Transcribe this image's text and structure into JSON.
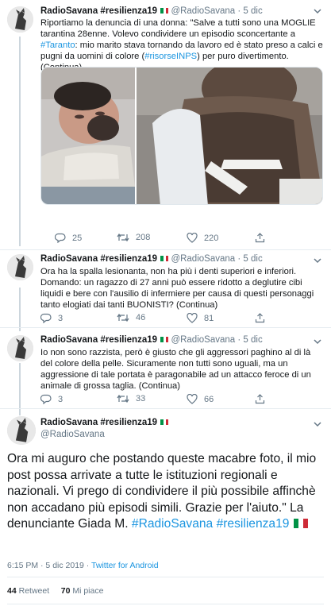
{
  "colors": {
    "link": "#1b95e0",
    "muted": "#657786",
    "text": "#14171a",
    "divider": "#e6ecf0",
    "like_red": "#e0245e"
  },
  "tweets": [
    {
      "name": "RadioSavana #resilienza19",
      "handle": "@RadioSavana",
      "date": "· 5 dic",
      "text_a": "Riportiamo la denuncia di una donna: \"Salve a tutti sono una MOGLIE tarantina 28enne. Volevo condividere un episodio sconcertante a ",
      "link_a": "#Taranto",
      "text_b": ": mio marito stava tornando da lavoro ed è stato preso a calci e pugni da uomini di colore (",
      "link_b": "#risorseINPS",
      "text_c": ") per puro divertimento. (Continua)",
      "replies": "25",
      "retweets": "208",
      "likes": "220"
    },
    {
      "name": "RadioSavana #resilienza19",
      "handle": "@RadioSavana",
      "date": "· 5 dic",
      "text": "Ora ha la spalla lesionanta, non ha più i denti superiori e inferiori. Domando: un ragazzo di 27 anni può essere ridotto a deglutire cibi liquidi e bere con l'ausilio di infermiere per causa di questi personaggi tanto elogiati dai tanti BUONISTI? (Continua)",
      "replies": "3",
      "retweets": "46",
      "likes": "81"
    },
    {
      "name": "RadioSavana #resilienza19",
      "handle": "@RadioSavana",
      "date": "· 5 dic",
      "text": "Io non sono razzista, però è giusto che gli aggressori paghino al di là del colore della pelle. Sicuramente non tutti sono uguali, ma un aggressione di tale portata è paragonabile ad un attacco feroce di un animale di grossa taglia. (Continua)",
      "replies": "3",
      "retweets": "33",
      "likes": "66"
    }
  ],
  "main_tweet": {
    "name": "RadioSavana #resilienza19",
    "handle": "@RadioSavana",
    "text": "Ora mi auguro che postando queste macabre foto, il mio post possa arrivate a tutte le istituzioni regionali e nazionali. Vi prego di condividere il più possibile affinchè non accadano più episodi simili. Grazie per l'aiuto.\" La denunciante Giada M. ",
    "hashtag1": "#RadioSavana",
    "hashtag2": "#resilienza19",
    "time": "6:15 PM · 5 dic 2019 · ",
    "source": "Twitter for Android",
    "retweet_count": "44",
    "retweet_label": "Retweet",
    "like_count": "70",
    "like_label": "Mi piace"
  }
}
